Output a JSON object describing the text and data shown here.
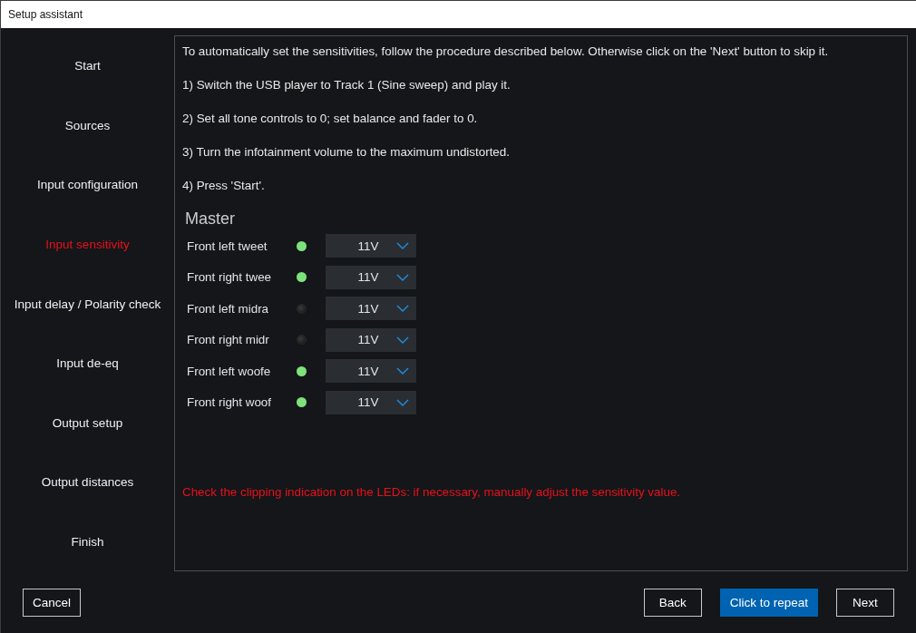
{
  "window": {
    "title": "Setup assistant"
  },
  "sidebar": {
    "items": [
      {
        "label": "Start",
        "selected": false
      },
      {
        "label": "Sources",
        "selected": false
      },
      {
        "label": "Input configuration",
        "selected": false
      },
      {
        "label": "Input sensitivity",
        "selected": true
      },
      {
        "label": "Input delay / Polarity check",
        "selected": false
      },
      {
        "label": "Input de-eq",
        "selected": false
      },
      {
        "label": "Output setup",
        "selected": false
      },
      {
        "label": "Output distances",
        "selected": false
      },
      {
        "label": "Finish",
        "selected": false
      }
    ]
  },
  "content": {
    "intro": "To automatically set the sensitivities, follow the procedure described below. Otherwise click on the 'Next' button to skip it.",
    "steps": [
      "1) Switch the USB player to Track 1 (Sine sweep) and play it.",
      "2) Set all tone controls to 0; set balance and fader to 0.",
      "3) Turn the infotainment volume to the maximum undistorted.",
      "4) Press 'Start'."
    ],
    "section": {
      "title": "Master",
      "channels": [
        {
          "name": "Front left tweet",
          "led_on": true,
          "value": "11V"
        },
        {
          "name": "Front right twee",
          "led_on": true,
          "value": "11V"
        },
        {
          "name": "Front left midra",
          "led_on": false,
          "value": "11V"
        },
        {
          "name": "Front right midr",
          "led_on": false,
          "value": "11V"
        },
        {
          "name": "Front left woofe",
          "led_on": true,
          "value": "11V"
        },
        {
          "name": "Front right woof",
          "led_on": true,
          "value": "11V"
        }
      ]
    },
    "warning": "Check the clipping indication on the LEDs: if necessary, manually adjust the sensitivity value."
  },
  "footer": {
    "left_buttons": [
      {
        "label": "Cancel",
        "kind": "outline"
      }
    ],
    "right_buttons": [
      {
        "label": "Back",
        "kind": "outline"
      },
      {
        "label": "Click to repeat",
        "kind": "primary"
      },
      {
        "label": "Next",
        "kind": "outline"
      }
    ]
  }
}
